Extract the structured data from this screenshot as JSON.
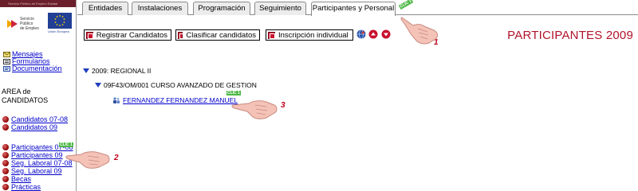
{
  "banner": {
    "text": "Servicio Público de Empleo Estatal"
  },
  "logos": {
    "sepe_text": "Servicio\nPúblico\nde Empleo",
    "eu_caption": "Unión Europea"
  },
  "quick_links": [
    {
      "label": "Mensajes",
      "icon": "envelope-icon"
    },
    {
      "label": "Formularios",
      "icon": "form-icon"
    },
    {
      "label": "Documentación",
      "icon": "document-icon"
    }
  ],
  "area_title": {
    "line1": "AREA de",
    "line2": "CANDIDATOS"
  },
  "candidate_links": [
    {
      "label": "Candidatos 07-08"
    },
    {
      "label": "Candidatos 09"
    }
  ],
  "participant_links": [
    {
      "label": "Participantes 07-08"
    },
    {
      "label": "Participantes 09"
    },
    {
      "label": "Seg. Laboral 07-08"
    },
    {
      "label": "Seg. Laboral 09"
    },
    {
      "label": "Becas"
    },
    {
      "label": "Prácticas"
    }
  ],
  "tabs": [
    {
      "label": "Entidades",
      "active": false
    },
    {
      "label": "Instalaciones",
      "active": false
    },
    {
      "label": "Programación",
      "active": false
    },
    {
      "label": "Seguimiento",
      "active": false
    },
    {
      "label": "Participantes y Personal",
      "active": true
    }
  ],
  "toolbar": {
    "register": "Registrar Candidatos",
    "classify": "Clasificar candidatos",
    "individual": "Inscripción individual",
    "icons": [
      "globe-icon",
      "arrow-up-icon",
      "arrow-down-icon"
    ]
  },
  "page_title": "PARTICIPANTES 2009",
  "tree": {
    "root": "2009: REGIONAL II",
    "course": "09F43/OM/001 CURSO AVANZADO DE GESTION",
    "person": "FERNANDEZ FERNANDEZ MANUEL"
  },
  "annotations": {
    "clic_label": "CLIC 1",
    "steps": [
      "1",
      "2",
      "3"
    ]
  },
  "colors": {
    "title_red": "#b1132a",
    "link_blue": "#0000cc",
    "tree_blue": "#1f3fbf",
    "banner": "#6b1f2a",
    "clic_green": "#4fb848",
    "step_red": "#c0001a"
  }
}
